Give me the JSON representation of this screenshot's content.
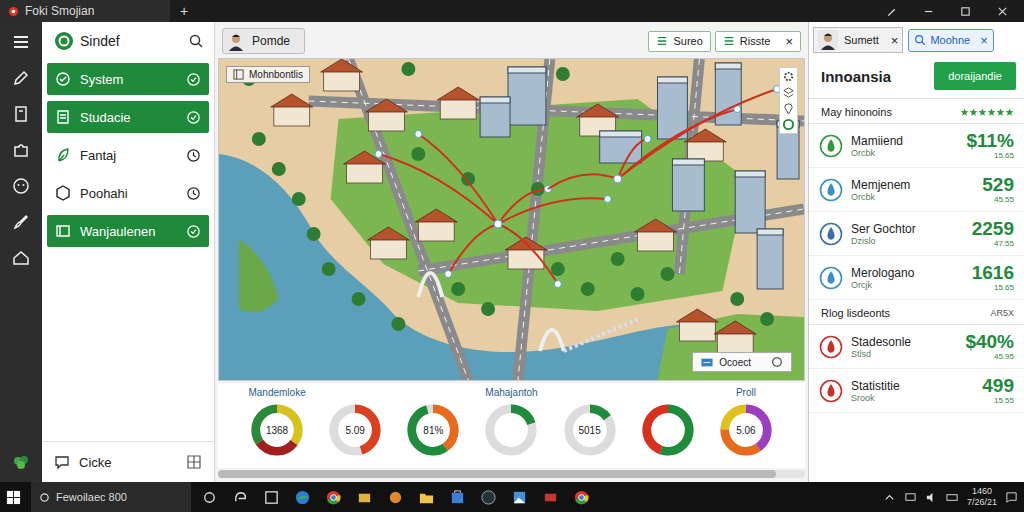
{
  "window": {
    "title": "Foki Smojian",
    "new_tab": "+"
  },
  "sidebar": {
    "title": "Sindef",
    "items": [
      {
        "label": "System",
        "selected": true
      },
      {
        "label": "Studacie",
        "selected": true
      },
      {
        "label": "Fantaj",
        "selected": false
      },
      {
        "label": "Poohahi",
        "selected": false
      },
      {
        "label": "Wanjaulenen",
        "selected": true
      }
    ],
    "footer": "Cicke"
  },
  "toolbar": {
    "user": "Pomde",
    "close": "×",
    "chips": [
      {
        "label": "Sureo",
        "closable": false
      },
      {
        "label": "Risste",
        "closable": true
      }
    ]
  },
  "map": {
    "label": "Mohnbontlis",
    "button": "Ocoect"
  },
  "gauges": {
    "labels": [
      "Mandemloke",
      "Mahajantoh",
      "Proll"
    ],
    "items": [
      {
        "value": "1368",
        "segments": [
          {
            "level": 0.35,
            "color": "#d8c21c"
          },
          {
            "level": 0.3,
            "color": "#a11f1f"
          },
          {
            "level": 0.35,
            "color": "#2a8a3a"
          }
        ]
      },
      {
        "value": "5.09",
        "segments": [
          {
            "level": 0.45,
            "color": "#d9401e"
          }
        ]
      },
      {
        "value": "81%",
        "segments": [
          {
            "level": 0.4,
            "color": "#e86a1c"
          },
          {
            "level": 0.55,
            "color": "#1e8c3a"
          }
        ]
      },
      {
        "segments": [
          {
            "level": 0.2,
            "color": "#1e8c3a"
          }
        ]
      },
      {
        "value": "5015",
        "segments": [
          {
            "level": 0.15,
            "color": "#1e8c3a"
          }
        ]
      },
      {
        "segments": [
          {
            "level": 0.55,
            "color": "#1e8c3a"
          },
          {
            "level": 0.45,
            "color": "#d9301e"
          }
        ]
      },
      {
        "value": "5.06",
        "segments": [
          {
            "level": 0.4,
            "color": "#9b3fc0"
          },
          {
            "level": 0.35,
            "color": "#e86a1c"
          },
          {
            "level": 0.25,
            "color": "#e0c31a"
          }
        ]
      }
    ]
  },
  "panel": {
    "user": "Sumett",
    "close": "×",
    "chip": "Moohne",
    "title": "Innoansia",
    "button": "doraijandie",
    "groups": [
      {
        "title": "May hinonoins",
        "stars": 6,
        "items": [
          {
            "name": "Mamiiend",
            "sub": "Orcbk",
            "value": "$11%",
            "detail": "15.65",
            "color": "#2e9a3e"
          },
          {
            "name": "Memjenem",
            "sub": "Orcbk",
            "value": "529",
            "detail": "45.55",
            "color": "#3a8fc4"
          },
          {
            "name": "Ser Gochtor",
            "sub": "Dzislo",
            "value": "2259",
            "detail": "47.55",
            "color": "#3a6fa8"
          },
          {
            "name": "Merologano",
            "sub": "Orcjk",
            "value": "1616",
            "detail": "15.65",
            "color": "#3a8fc4"
          }
        ]
      },
      {
        "title": "Rlog lisdeonts",
        "note": "AR5X",
        "items": [
          {
            "name": "Stadesonle",
            "sub": "Stlsd",
            "value": "$40%",
            "detail": "45.95",
            "color": "#c8302a"
          },
          {
            "name": "Statistitie",
            "sub": "Srook",
            "value": "499",
            "detail": "15.55",
            "color": "#c8302a"
          }
        ]
      }
    ]
  },
  "taskbar": {
    "search": "Fewoilaec 800",
    "time": "1460",
    "date": "7/26/21"
  }
}
